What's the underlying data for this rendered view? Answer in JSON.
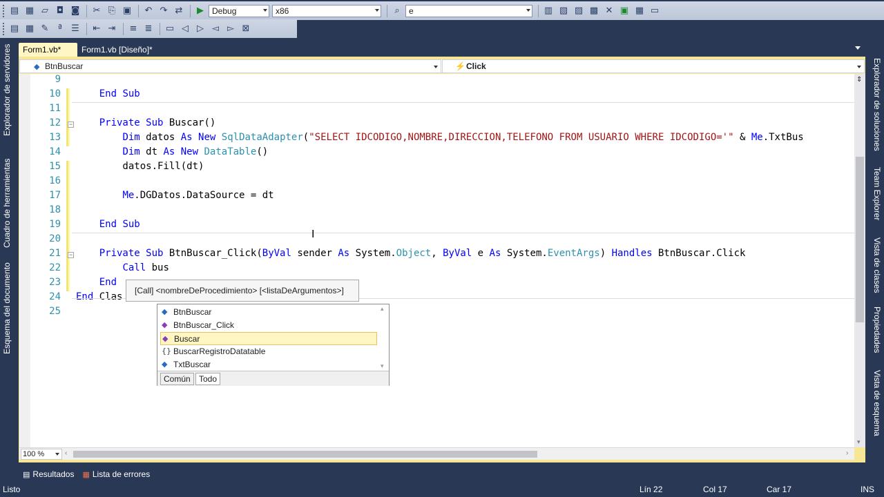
{
  "toolbar": {
    "config_value": "Debug",
    "platform_value": "x86",
    "find_value": "e"
  },
  "side_left": [
    "Explorador de servidores",
    "Cuadro de herramientas",
    "Esquema del documento"
  ],
  "side_right": [
    "Explorador de soluciones",
    "Team Explorer",
    "Vista de clases",
    "Propiedades",
    "Vista de esquema"
  ],
  "tabs": [
    {
      "label": "Form1.vb*"
    },
    {
      "label": "Form1.vb [Diseño]*"
    }
  ],
  "nav": {
    "left": "BtnBuscar",
    "right": "Click"
  },
  "line_numbers": [
    "9",
    "10",
    "11",
    "12",
    "13",
    "14",
    "15",
    "16",
    "17",
    "18",
    "19",
    "20",
    "21",
    "22",
    "23",
    "24",
    "25"
  ],
  "code_lines": [
    "",
    "    End Sub",
    "",
    "    Private Sub Buscar()",
    "        Dim datos As New SqlDataAdapter(\"SELECT IDCODIGO,NOMBRE,DIRECCION,TELEFONO FROM USUARIO WHERE IDCODIGO='\" & Me.TxtBus",
    "        Dim dt As New DataTable()",
    "        datos.Fill(dt)",
    "",
    "        Me.DGDatos.DataSource = dt",
    "",
    "    End Sub",
    "",
    "    Private Sub BtnBuscar_Click(ByVal sender As System.Object, ByVal e As System.EventArgs) Handles BtnBuscar.Click",
    "        Call bus",
    "    End",
    "End Clas",
    ""
  ],
  "tooltip": "[Call] <nombreDeProcedimiento> [<listaDeArgumentos>]",
  "completion": {
    "items": [
      {
        "label": "BtnBuscar",
        "icon": "field-icon"
      },
      {
        "label": "BtnBuscar_Click",
        "icon": "method-icon"
      },
      {
        "label": "Buscar",
        "icon": "method-icon",
        "selected": true
      },
      {
        "label": "BuscarRegistroDatatable",
        "icon": "namespace-icon"
      },
      {
        "label": "TxtBuscar",
        "icon": "field-icon"
      }
    ],
    "tabs": [
      "Común",
      "Todo"
    ],
    "active_tab": "Todo"
  },
  "zoom": "100 %",
  "bottom_tabs": [
    "Resultados",
    "Lista de errores"
  ],
  "status": {
    "text": "Listo",
    "line": "Lín 22",
    "col": "Col 17",
    "car": "Car 17",
    "mode": "INS"
  }
}
